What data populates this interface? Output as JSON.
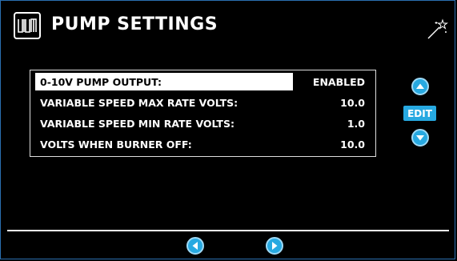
{
  "header": {
    "logo_icon": "wm-logo-icon",
    "title": "PUMP SETTINGS",
    "wand_icon": "magic-wand-icon"
  },
  "settings": [
    {
      "label": "0-10V PUMP OUTPUT:",
      "value": "ENABLED",
      "selected": true
    },
    {
      "label": "VARIABLE SPEED MAX RATE VOLTS:",
      "value": "10.0",
      "selected": false
    },
    {
      "label": "VARIABLE SPEED MIN RATE VOLTS:",
      "value": "1.0",
      "selected": false
    },
    {
      "label": "VOLTS WHEN BURNER OFF:",
      "value": "10.0",
      "selected": false
    }
  ],
  "controls": {
    "up_icon": "chevron-up-icon",
    "edit_label": "EDIT",
    "down_icon": "chevron-down-icon",
    "prev_icon": "chevron-left-icon",
    "next_icon": "chevron-right-icon"
  },
  "colors": {
    "accent": "#27a9e1",
    "background": "#000000",
    "text": "#ffffff"
  }
}
